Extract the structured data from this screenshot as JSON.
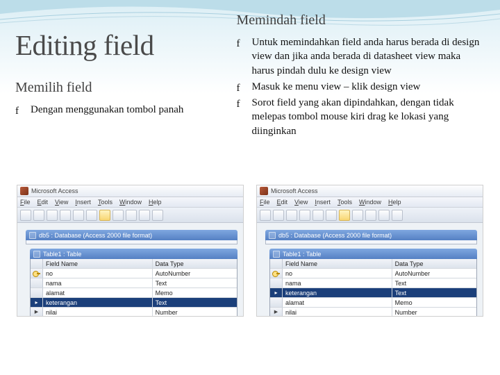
{
  "left": {
    "main_title": "Editing field",
    "sub_title": "Memilih field",
    "bullets": [
      "Dengan menggunakan tombol panah"
    ]
  },
  "right": {
    "sub_title": "Memindah field",
    "bullets": [
      "Untuk memindahkan field anda harus berada  di design view dan jika anda berada di datasheet view maka harus pindah dulu ke design view",
      "Masuk ke menu view – klik design view",
      "Sorot field yang akan dipindahkan, dengan tidak melepas tombol mouse kiri drag ke lokasi yang diinginkan"
    ]
  },
  "screenshot_left": {
    "app_title": "Microsoft Access",
    "menu": [
      "File",
      "Edit",
      "View",
      "Insert",
      "Tools",
      "Window",
      "Help"
    ],
    "db_title": "db5 : Database (Access 2000 file format)",
    "tbl_title": "Table1 : Table",
    "headers": [
      "",
      "Field Name",
      "Data Type"
    ],
    "rows": [
      {
        "sel": "key",
        "name": "no",
        "type": "AutoNumber"
      },
      {
        "sel": "",
        "name": "nama",
        "type": "Text"
      },
      {
        "sel": "",
        "name": "alamat",
        "type": "Memo"
      },
      {
        "sel": "sel",
        "name": "keterangan",
        "type": "Text"
      },
      {
        "sel": "cur",
        "name": "nilai",
        "type": "Number"
      }
    ]
  },
  "screenshot_right": {
    "app_title": "Microsoft Access",
    "menu": [
      "File",
      "Edit",
      "View",
      "Insert",
      "Tools",
      "Window",
      "Help"
    ],
    "db_title": "db5 : Database (Access 2000 file format)",
    "tbl_title": "Table1 : Table",
    "headers": [
      "",
      "Field Name",
      "Data Type"
    ],
    "rows": [
      {
        "sel": "key",
        "name": "no",
        "type": "AutoNumber"
      },
      {
        "sel": "",
        "name": "nama",
        "type": "Text"
      },
      {
        "sel": "sel",
        "name": "keterangan",
        "type": "Text"
      },
      {
        "sel": "",
        "name": "alamat",
        "type": "Memo"
      },
      {
        "sel": "cur",
        "name": "nilai",
        "type": "Number"
      }
    ]
  }
}
